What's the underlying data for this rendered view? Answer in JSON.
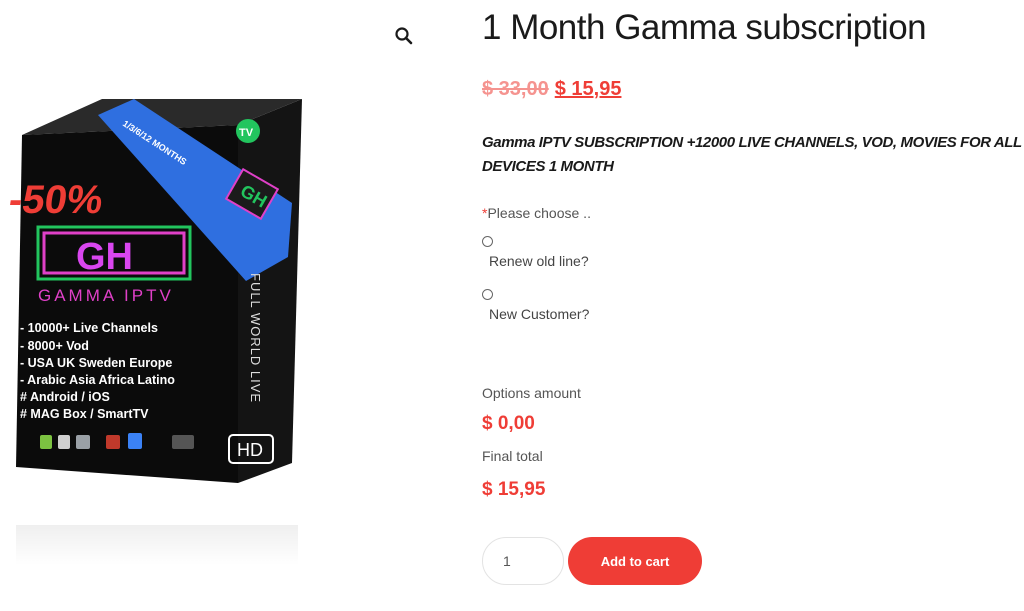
{
  "product": {
    "title": "1 Month Gamma subscription",
    "old_price": "$ 33,00",
    "new_price": "$ 15,95",
    "description": "Gamma IPTV SUBSCRIPTION +12000 LIVE CHANNELS, VOD, MOVIES FOR ALL DEVICES 1 MONTH"
  },
  "options": {
    "required_mark": "*",
    "prompt": "Please choose ..",
    "choices": [
      {
        "label": "Renew old line?",
        "selected": false
      },
      {
        "label": "New Customer?",
        "selected": false
      }
    ]
  },
  "totals": {
    "options_label": "Options amount",
    "options_value": "$ 0,00",
    "final_label": "Final total",
    "final_value": "$ 15,95"
  },
  "cart": {
    "quantity": "1",
    "button_label": "Add to cart"
  },
  "image": {
    "badge_tv": "TV",
    "ribbon": "1/3/6/12 MONTHS",
    "discount": "-50%",
    "logo_letters": "GH",
    "brand": "GAMMA IPTV",
    "features": [
      "- 10000+ Live Channels",
      "- 8000+ Vod",
      "- USA UK Sweden Europe",
      "- Arabic Asia Africa Latino",
      "# Android / iOS",
      "# MAG Box / SmartTV"
    ],
    "side_text": "FULL WORLD LIVE",
    "hd": "HD",
    "icons": [
      "android-icon",
      "apple-icon",
      "mag-box-icon",
      "iptv-icon",
      "kodi-icon",
      "enigma-icon"
    ]
  },
  "colors": {
    "accent": "#ef3d36",
    "old_price": "#f5938f",
    "ribbon": "#2f6fe0",
    "logo_green": "#22c55e",
    "logo_magenta": "#e040c8"
  }
}
